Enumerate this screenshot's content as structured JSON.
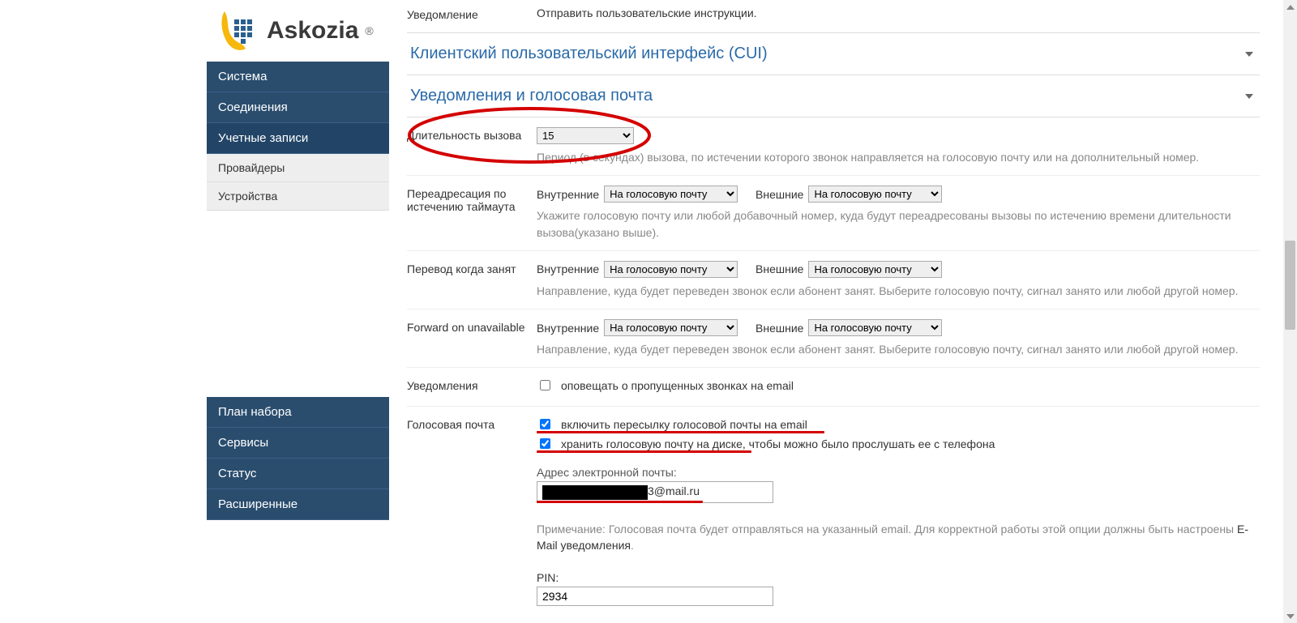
{
  "brand": {
    "name": "Askozia"
  },
  "sidebar": {
    "system": "Система",
    "connections": "Соединения",
    "accounts": "Учетные записи",
    "providers": "Провайдеры",
    "devices": "Устройства",
    "dialplan": "План набора",
    "services": "Сервисы",
    "status": "Статус",
    "advanced": "Расширенные"
  },
  "top": {
    "notification_label": "Уведомление",
    "notification_value": "Отправить пользовательские инструкции."
  },
  "sections": {
    "cui": "Клиентский пользовательский интерфейс (CUI)",
    "notifications_voicemail": "Уведомления и голосовая почта"
  },
  "rows": {
    "call_duration": {
      "label": "Длительность вызова",
      "value": "15",
      "hint": "Период (в секундах) вызова, по истечении которого звонок направляется на голосовую почту или на дополнительный номер."
    },
    "forward_timeout": {
      "label": "Переадресация по истечению таймаута",
      "internal_label": "Внутренние",
      "external_label": "Внешние",
      "internal_value": "На голосовую почту",
      "external_value": "На голосовую почту",
      "hint": "Укажите голосовую почту или любой добавочный номер, куда будут переадресованы вызовы по истечению времени длительности вызова(указано выше)."
    },
    "forward_busy": {
      "label": "Перевод когда занят",
      "internal_label": "Внутренние",
      "external_label": "Внешние",
      "internal_value": "На голосовую почту",
      "external_value": "На голосовую почту",
      "hint": "Направление, куда будет переведен звонок если абонент занят. Выберите голосовую почту, сигнал занято или любой другой номер."
    },
    "forward_unavailable": {
      "label": "Forward on unavailable",
      "internal_label": "Внутренние",
      "external_label": "Внешние",
      "internal_value": "На голосовую почту",
      "external_value": "На голосовую почту",
      "hint": "Направление, куда будет переведен звонок если абонент занят. Выберите голосовую почту, сигнал занято или любой другой номер."
    },
    "notifications": {
      "label": "Уведомления",
      "missed_calls_email": "оповещать о пропущенных звонках на email"
    },
    "voicemail": {
      "label": "Голосовая почта",
      "enable_forward_email": "включить пересылку голосовой почты на email",
      "store_on_disk": "хранить голосовую почту на диске, чтобы можно было прослушать ее с телефона",
      "email_label": "Адрес электронной почты:",
      "email_value_suffix": "3@mail.ru",
      "note_prefix": "Примечание: Голосовая почта будет отправляться на указанный email. Для корректной работы этой опции должны быть настроены ",
      "note_link": "E-Mail уведомления",
      "note_suffix": ".",
      "pin_label": "PIN:",
      "pin_value": "2934"
    }
  }
}
